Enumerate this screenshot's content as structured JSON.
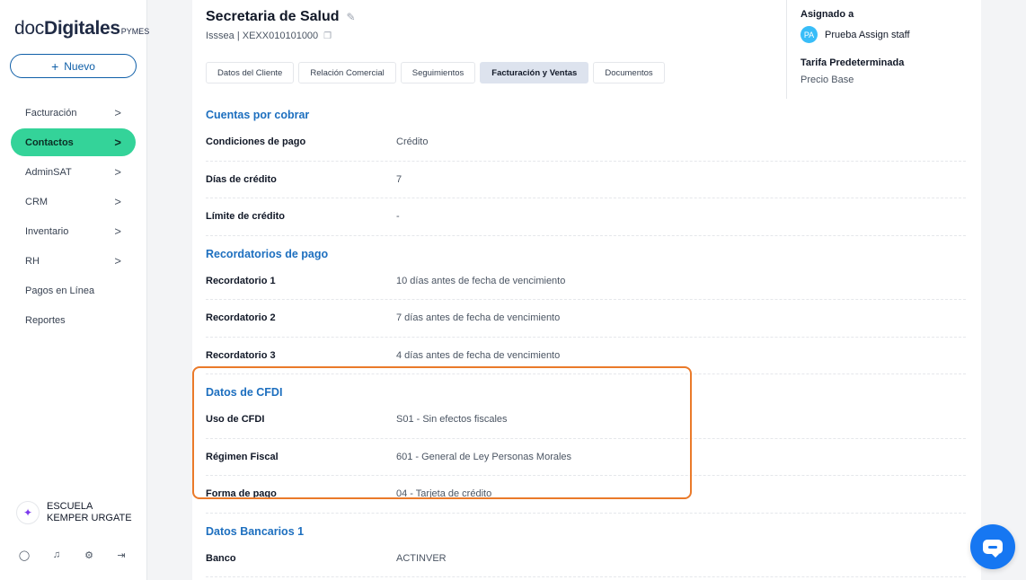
{
  "brand": {
    "doc": "doc",
    "digitales": "Digitales",
    "pymes": "PYMES"
  },
  "new_button": {
    "icon": "+",
    "label": "Nuevo"
  },
  "nav": [
    {
      "label": "Facturación",
      "chevron": ">",
      "active": false
    },
    {
      "label": "Contactos",
      "chevron": ">",
      "active": true
    },
    {
      "label": "AdminSAT",
      "chevron": ">",
      "active": false
    },
    {
      "label": "CRM",
      "chevron": ">",
      "active": false
    },
    {
      "label": "Inventario",
      "chevron": ">",
      "active": false
    },
    {
      "label": "RH",
      "chevron": ">",
      "active": false
    },
    {
      "label": "Pagos en Línea",
      "chevron": "",
      "active": false
    },
    {
      "label": "Reportes",
      "chevron": "",
      "active": false
    }
  ],
  "organization": {
    "name": "ESCUELA KEMPER URGATE"
  },
  "footer_icons": [
    "user-circle-icon",
    "bell-icon",
    "gear-icon",
    "logout-icon"
  ],
  "contact": {
    "name": "Secretaria de Salud",
    "subtitle": "Isssea | XEXX010101000"
  },
  "tabs": [
    {
      "label": "Datos del Cliente",
      "active": false
    },
    {
      "label": "Relación Comercial",
      "active": false
    },
    {
      "label": "Seguimientos",
      "active": false
    },
    {
      "label": "Facturación y Ventas",
      "active": true
    },
    {
      "label": "Documentos",
      "active": false
    }
  ],
  "right_panel": {
    "assigned_label": "Asignado a",
    "assignee_initials": "PA",
    "assignee_name": "Prueba Assign staff",
    "tarifa_label": "Tarifa Predeterminada",
    "tarifa_value": "Precio Base"
  },
  "sections": {
    "cuentas": {
      "title": "Cuentas por cobrar",
      "rows": [
        {
          "label": "Condiciones de pago",
          "value": "Crédito"
        },
        {
          "label": "Días de crédito",
          "value": "7"
        },
        {
          "label": "Límite de crédito",
          "value": "-"
        }
      ]
    },
    "recordatorios": {
      "title": "Recordatorios de pago",
      "rows": [
        {
          "label": "Recordatorio 1",
          "value": "10 días antes de fecha de vencimiento"
        },
        {
          "label": "Recordatorio 2",
          "value": "7 días antes de fecha de vencimiento"
        },
        {
          "label": "Recordatorio 3",
          "value": "4 días antes de fecha de vencimiento"
        }
      ]
    },
    "cfdi": {
      "title": "Datos de CFDI",
      "rows": [
        {
          "label": "Uso de CFDI",
          "value": "S01 - Sin efectos fiscales"
        },
        {
          "label": "Régimen Fiscal",
          "value": "601 - General de Ley Personas Morales"
        },
        {
          "label": "Forma de pago",
          "value": "04 - Tarjeta de crédito"
        }
      ]
    },
    "bancarios": {
      "title": "Datos Bancarios 1",
      "rows": [
        {
          "label": "Banco",
          "value": "ACTINVER"
        }
      ]
    }
  },
  "colors": {
    "accent_green": "#34d399",
    "brand_blue": "#0f5fa8",
    "section_blue": "#1d6fbf",
    "highlight_orange": "#ea7a2a",
    "chat_blue": "#1677f2"
  }
}
